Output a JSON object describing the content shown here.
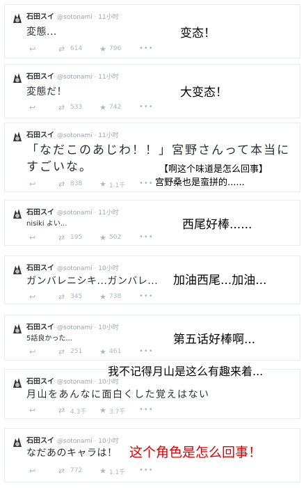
{
  "tweets": [
    {
      "name": "石田スイ",
      "handle": "@sotonami · 11小时",
      "text": "変態...",
      "retweets": "614",
      "favorites": "796",
      "caption": "变态！"
    },
    {
      "name": "石田スイ",
      "handle": "@sotonami · 11小时",
      "text": "変態だ！",
      "retweets": "533",
      "favorites": "742",
      "caption": "大变态！"
    },
    {
      "name": "石田スイ",
      "handle": "@sotonami · 11小时",
      "text_line1": "「なだこのあじわ！！」宮野さんって本当に",
      "text_line2": "すごいな。",
      "retweets": "838",
      "favorites": "1.1千",
      "caption_line1": "【啊这个味道是怎么回事】",
      "caption_line2": "宫野桑也是蛮拼的......"
    },
    {
      "name": "石田スイ",
      "handle": "@sotonami · 11小时",
      "text": "nisiki よい...",
      "retweets": "195",
      "favorites": "502",
      "caption": "西尾好棒......"
    },
    {
      "name": "石田スイ",
      "handle": "@sotonami · 10小时",
      "text": "ガンバレニシキ...ガンバレ...",
      "retweets": "345",
      "favorites": "738",
      "caption": "加油西尾...加油..."
    },
    {
      "name": "石田スイ",
      "handle": "@sotonami · 10小时",
      "text": "5話良かった...",
      "retweets": "251",
      "favorites": "461",
      "caption": "第五话好棒啊..."
    },
    {
      "name": "石田スイ",
      "handle": "@sotonami · 10小时",
      "text": "月山をあんなに面白くした覚えはない",
      "retweets": "4.3千",
      "favorites": "3.7千",
      "caption": "我不记得月山是这么有趣来着..."
    },
    {
      "name": "石田スイ",
      "handle": "@sotonami · 10小时",
      "text": "なだあのキャラは！",
      "retweets": "772",
      "favorites": "1.1千",
      "caption": "这个角色是怎么回事！"
    }
  ],
  "icons": {
    "reply": "reply-icon",
    "retweet": "retweet-icon",
    "favorite": "star-icon",
    "more": "more-icon"
  },
  "colors": {
    "icon": "#aab8c2",
    "caption_red": "#e00000"
  }
}
